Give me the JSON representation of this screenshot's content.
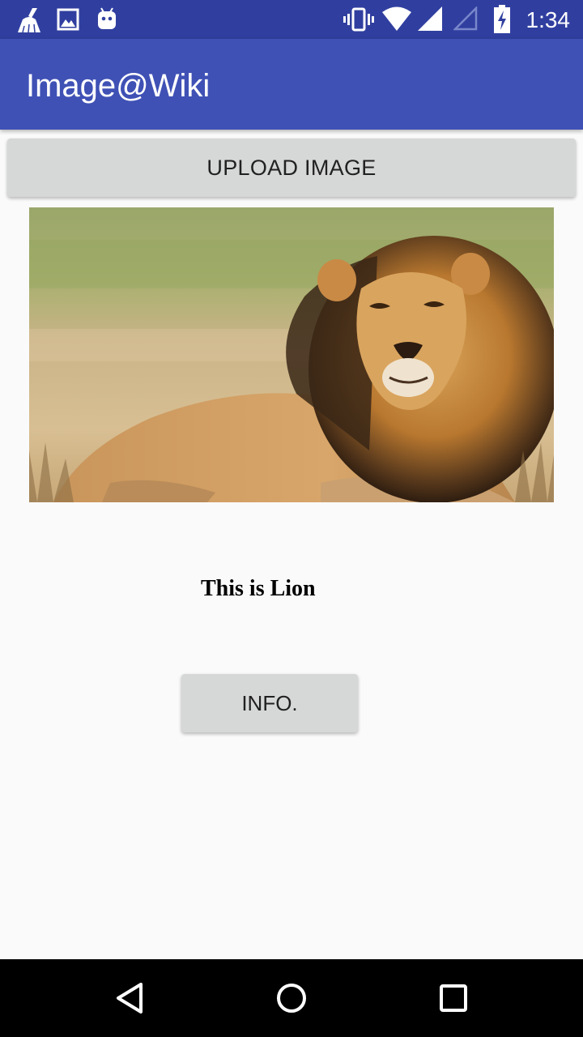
{
  "status_bar": {
    "time": "1:34",
    "icons": [
      "cleaner-broom-icon",
      "gallery-image-icon",
      "android-robot-icon",
      "vibrate-icon",
      "wifi-icon",
      "cell-signal-icon",
      "cell-signal-empty-icon",
      "battery-charging-icon"
    ]
  },
  "app_bar": {
    "title": "Image@Wiki"
  },
  "upload_button": {
    "label": "UPLOAD IMAGE"
  },
  "image": {
    "subject": "lion-photo"
  },
  "caption": {
    "text": "This is Lion"
  },
  "info_button": {
    "label": "INFO."
  },
  "nav_bar": {
    "icons": [
      "back-icon",
      "home-icon",
      "recents-icon"
    ]
  },
  "colors": {
    "status_bar": "#303f9f",
    "app_bar": "#3f51b5",
    "button": "#d6d7d7",
    "background": "#fafafa"
  }
}
